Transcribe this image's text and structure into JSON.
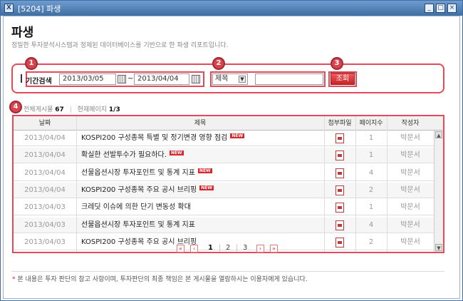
{
  "window": {
    "title": "[5204] 파생",
    "icon": "app-x-icon"
  },
  "page": {
    "title": "파생",
    "subtitle": "정밀한 투자분석시스템과 정제된 데이터베이스를 기반으로 한 파생 리포트입니다."
  },
  "markers": [
    "1",
    "2",
    "3",
    "4"
  ],
  "search": {
    "period_label": "기간검색",
    "date_from": "2013/03/05",
    "separator": "~",
    "date_to": "2013/04/04",
    "field_select": "제목",
    "keyword": "",
    "search_button": "조회"
  },
  "summary": {
    "total_label": "전체게시물",
    "total_count": "67",
    "divider": "|",
    "page_label": "현재페이지",
    "page_value": "1/3"
  },
  "table": {
    "headers": [
      "날짜",
      "제목",
      "첨부파일",
      "페이지수",
      "작성자"
    ],
    "new_badge": "NEW",
    "rows": [
      {
        "date": "2013/04/04",
        "subject": "KOSPI200 구성종목 특별 및 정기변경 영향 점검",
        "is_new": true,
        "pages": "1",
        "author": "박문서"
      },
      {
        "date": "2013/04/04",
        "subject": "확실한 선발투수가 필요하다.",
        "is_new": true,
        "pages": "1",
        "author": "박문서"
      },
      {
        "date": "2013/04/04",
        "subject": "선물옵션시장 투자포인트 및 통계 지표",
        "is_new": true,
        "pages": "4",
        "author": "박문서"
      },
      {
        "date": "2013/04/04",
        "subject": "KOSPI200 구성종목 주요 공시 브리핑",
        "is_new": true,
        "pages": "2",
        "author": "박문서"
      },
      {
        "date": "2013/04/03",
        "subject": "크레딧 이슈에 의한 단기 변동성 확대",
        "is_new": false,
        "pages": "1",
        "author": "박문서"
      },
      {
        "date": "2013/04/03",
        "subject": "선물옵션시장 투자포인트 및 통계 지표",
        "is_new": false,
        "pages": "4",
        "author": "박문서"
      },
      {
        "date": "2013/04/03",
        "subject": "KOSPI200 구성종목 주요 공시 브리핑",
        "is_new": false,
        "pages": "2",
        "author": "박문서"
      }
    ]
  },
  "pagination": {
    "first": "«",
    "prev": "‹",
    "pages": [
      "1",
      "2",
      "3"
    ],
    "current": "1",
    "separator": "|",
    "next": "›",
    "last": "»"
  },
  "notice": {
    "star": "*",
    "text": "본 내용은 투자 판단의 참고 사항이며, 투자판단의 최종 책임은 본 게시물을 열람하시는 이용자에게 있습니다."
  },
  "colors": {
    "accent": "#e34b5b",
    "titlebar": "#3f6ea3",
    "button": "#c8242a"
  }
}
